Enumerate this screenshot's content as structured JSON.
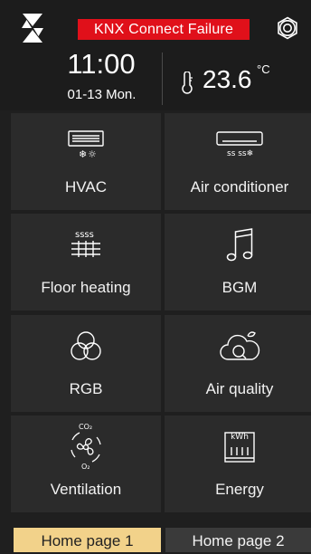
{
  "status": {
    "alert_text": "KNX Connect Failure"
  },
  "clock": {
    "time": "11:00",
    "date": "01-13  Mon."
  },
  "temperature": {
    "value": "23.6",
    "unit": "°C"
  },
  "tiles": [
    {
      "label": "HVAC",
      "icon": "hvac-icon"
    },
    {
      "label": "Air conditioner",
      "icon": "air-conditioner-icon"
    },
    {
      "label": "Floor heating",
      "icon": "floor-heating-icon"
    },
    {
      "label": "BGM",
      "icon": "music-note-icon"
    },
    {
      "label": "RGB",
      "icon": "rgb-circles-icon"
    },
    {
      "label": "Air quality",
      "icon": "air-quality-icon"
    },
    {
      "label": "Ventilation",
      "icon": "ventilation-fan-icon",
      "icon_text_top": "CO₂",
      "icon_text_bottom": "O₂"
    },
    {
      "label": "Energy",
      "icon": "energy-meter-icon",
      "icon_text": "kWh"
    }
  ],
  "tabs": [
    {
      "label": "Home page 1",
      "active": true
    },
    {
      "label": "Home page 2",
      "active": false
    }
  ],
  "colors": {
    "alert_bg": "#e0101a",
    "active_tab_bg": "#f2d28a",
    "tile_bg": "#2b2b2b",
    "background": "#1f1f1f"
  }
}
